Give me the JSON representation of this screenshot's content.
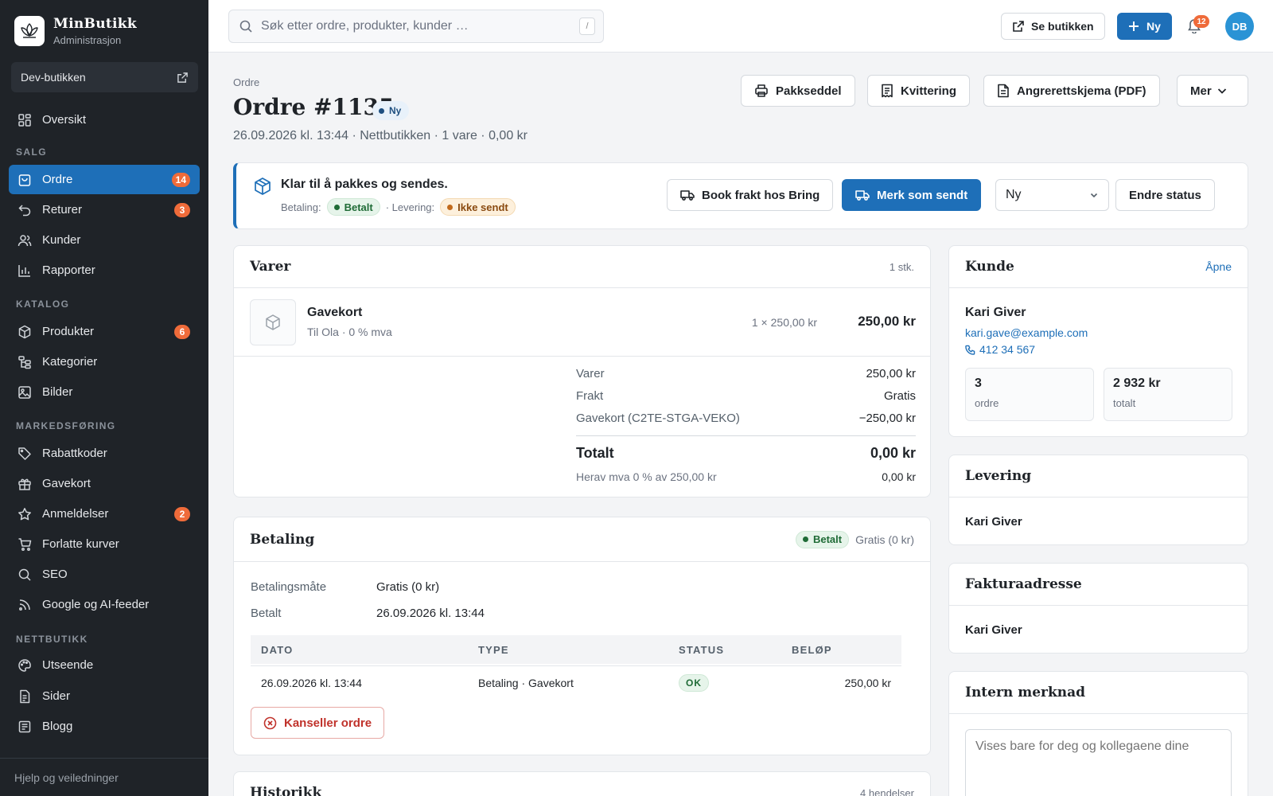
{
  "brand": {
    "name": "MinButikk",
    "subtitle": "Administrasjon"
  },
  "shop": {
    "name": "Dev-butikken"
  },
  "nav": {
    "overview": "Oversikt",
    "sections": {
      "sales": "SALG",
      "catalog": "KATALOG",
      "marketing": "MARKEDSFØRING",
      "store": "NETTBUTIKK"
    },
    "items": [
      {
        "label": "Ordre",
        "badge": "14",
        "active": true
      },
      {
        "label": "Returer",
        "badge": "3"
      },
      {
        "label": "Kunder"
      },
      {
        "label": "Rapporter"
      },
      {
        "label": "Produkter",
        "badge": "6"
      },
      {
        "label": "Kategorier"
      },
      {
        "label": "Bilder"
      },
      {
        "label": "Rabattkoder"
      },
      {
        "label": "Gavekort"
      },
      {
        "label": "Anmeldelser",
        "badge": "2"
      },
      {
        "label": "Forlatte kurver"
      },
      {
        "label": "SEO"
      },
      {
        "label": "Google og AI-feeder"
      },
      {
        "label": "Utseende"
      },
      {
        "label": "Sider"
      },
      {
        "label": "Blogg"
      }
    ],
    "footer": "Hjelp og veiledninger"
  },
  "topbar": {
    "search_placeholder": "Søk etter ordre, produkter, kunder …",
    "search_shortcut": "/",
    "view_store": "Se butikken",
    "new": "Ny",
    "notifications": "12",
    "avatar": "DB"
  },
  "order": {
    "breadcrumb": "Ordre",
    "title": "Ordre #1135",
    "status_badge": "Ny",
    "meta": "26.09.2026 kl. 13:44 · Nettbutikken · 1 vare · 0,00 kr",
    "actions": {
      "packing_slip": "Pakkseddel",
      "receipt": "Kvittering",
      "withdrawal_form": "Angrerettskjema (PDF)",
      "more": "Mer"
    }
  },
  "status_panel": {
    "headline": "Klar til å pakkes og sendes.",
    "payment_label": "Betaling:",
    "payment_value": "Betalt",
    "delivery_label": "· Levering:",
    "delivery_value": "Ikke sendt",
    "book_shipping": "Book frakt hos Bring",
    "mark_sent": "Merk som sendt",
    "status_select": "Ny",
    "change_status": "Endre status"
  },
  "items_card": {
    "title": "Varer",
    "count": "1 stk.",
    "item": {
      "name": "Gavekort",
      "detail": "Til Ola · 0 % mva",
      "qty_price": "1 × 250,00 kr",
      "total": "250,00 kr"
    },
    "summary": [
      {
        "label": "Varer",
        "value": "250,00 kr"
      },
      {
        "label": "Frakt",
        "value": "Gratis"
      },
      {
        "label": "Gavekort (C2TE-STGA-VEKO)",
        "value": "−250,00 kr"
      }
    ],
    "total_label": "Totalt",
    "total_value": "0,00 kr",
    "vat_label": "Herav mva 0 % av 250,00 kr",
    "vat_value": "0,00 kr"
  },
  "payment_card": {
    "title": "Betaling",
    "badge": "Betalt",
    "badge_note": "Gratis (0 kr)",
    "method_label": "Betalingsmåte",
    "method_value": "Gratis (0 kr)",
    "paid_label": "Betalt",
    "paid_value": "26.09.2026 kl. 13:44",
    "columns": [
      "DATO",
      "TYPE",
      "STATUS",
      "BELØP"
    ],
    "rows": [
      {
        "date": "26.09.2026 kl. 13:44",
        "type": "Betaling · Gavekort",
        "status": "OK",
        "amount": "250,00 kr"
      }
    ],
    "cancel": "Kanseller ordre"
  },
  "history_card": {
    "title": "Historikk",
    "count": "4 hendelser"
  },
  "customer_card": {
    "title": "Kunde",
    "open": "Åpne",
    "name": "Kari Giver",
    "email": "kari.gave@example.com",
    "phone": "412 34 567",
    "orders_value": "3",
    "orders_label": "ordre",
    "total_value": "2 932 kr",
    "total_label": "totalt"
  },
  "delivery_card": {
    "title": "Levering",
    "name": "Kari Giver"
  },
  "billing_card": {
    "title": "Fakturaadresse",
    "name": "Kari Giver"
  },
  "note_card": {
    "title": "Intern merknad",
    "placeholder": "Vises bare for deg og kollegaene dine"
  },
  "colors": {
    "accent": "#1e6fb8",
    "sidebar": "#1f2328",
    "badge": "#ef6b3a",
    "success": "#1f6b36",
    "warning": "#8a4a10"
  }
}
